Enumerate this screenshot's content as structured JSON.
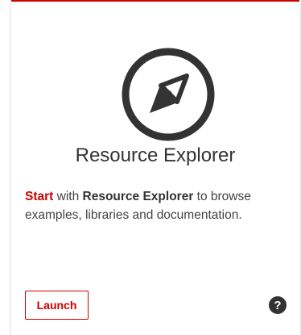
{
  "card": {
    "title": "Resource Explorer",
    "icon": "compass-icon",
    "description": {
      "lead": "Start",
      "part1": " with ",
      "emphasis": "Resource Explorer",
      "part2": " to browse examples, libraries and documentation."
    },
    "launch_label": "Launch",
    "help_icon": "help-icon",
    "help_glyph": "?"
  },
  "colors": {
    "accent": "#cc0000",
    "icon": "#333333",
    "text": "#444444"
  }
}
